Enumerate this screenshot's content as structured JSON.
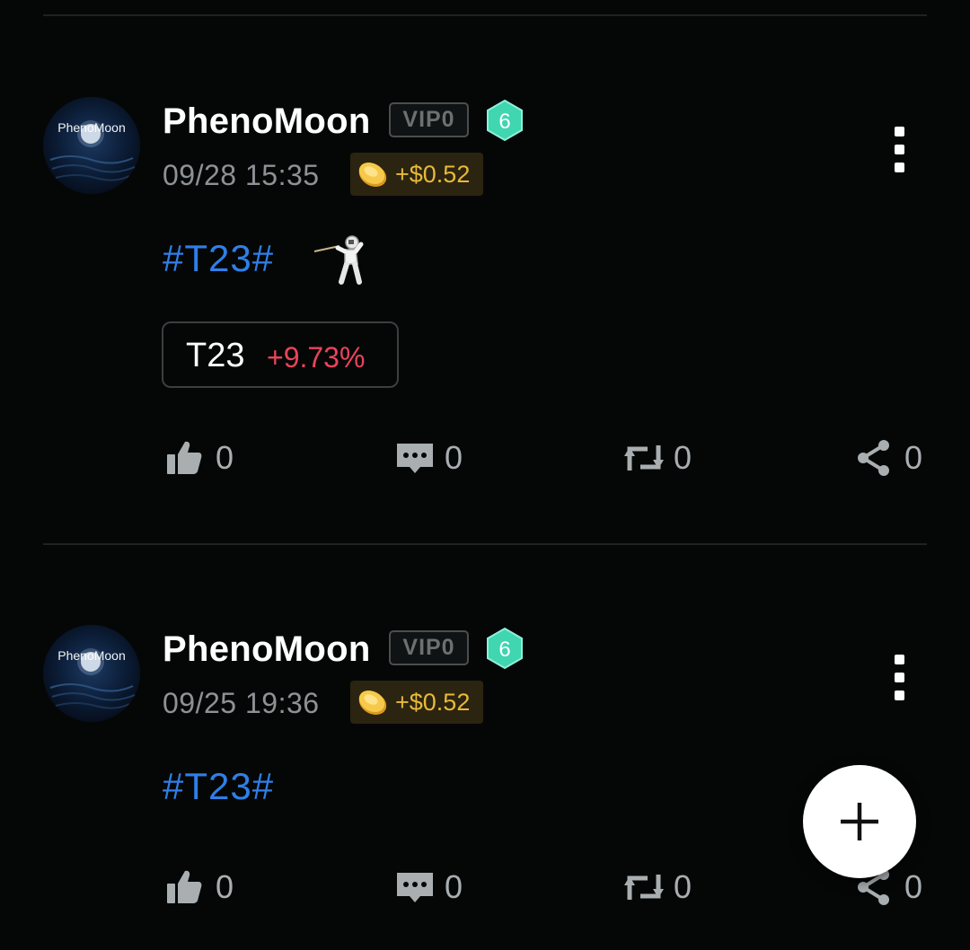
{
  "feed": {
    "posts": [
      {
        "username": "PhenoMoon",
        "vip_badge": "VIP0",
        "level": "6",
        "timestamp": "09/28 15:35",
        "reward": "+$0.52",
        "hashtag": "#T23#",
        "emoji_icon": "fencer-icon",
        "stock": {
          "symbol": "T23",
          "change": "+9.73%"
        },
        "actions": {
          "likes": "0",
          "comments": "0",
          "reposts": "0",
          "shares": "0"
        }
      },
      {
        "username": "PhenoMoon",
        "vip_badge": "VIP0",
        "level": "6",
        "timestamp": "09/25 19:36",
        "reward": "+$0.52",
        "hashtag": "#T23#",
        "actions": {
          "likes": "0",
          "comments": "0",
          "reposts": "0",
          "shares": "0"
        }
      }
    ]
  },
  "avatar_text": "PhenoMoon",
  "colors": {
    "background": "#050707",
    "hashtag": "#2f7fe8",
    "gain": "#e9445a",
    "reward": "#e8b93a",
    "level_badge": "#3fd6b0"
  },
  "fab": {
    "icon": "plus-icon"
  }
}
